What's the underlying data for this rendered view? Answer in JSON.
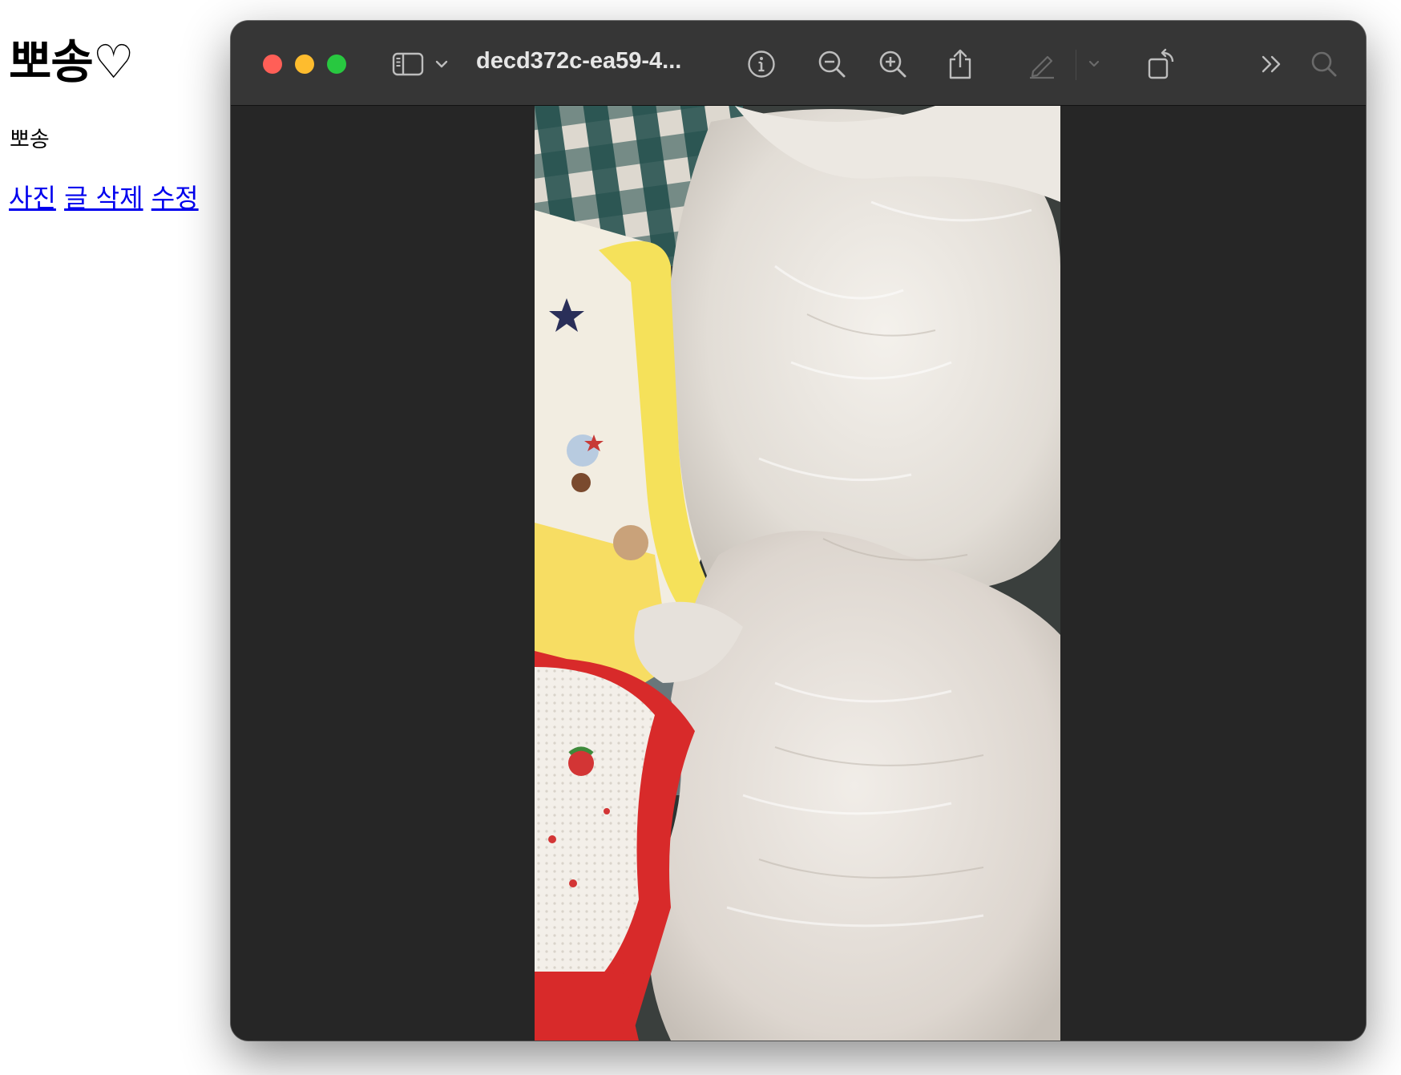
{
  "page": {
    "title": "뽀송♡",
    "subtitle": "뽀송",
    "links": [
      "사진",
      "글 삭제",
      "수정"
    ]
  },
  "window": {
    "title": "decd372c-ea59-4...",
    "traffic_lights": {
      "close": "#ff5f57",
      "minimize": "#febc2e",
      "zoom": "#28c840"
    },
    "toolbar_icons": [
      "sidebar-toggle-icon",
      "chevron-down-icon",
      "info-icon",
      "zoom-out-icon",
      "zoom-in-icon",
      "share-icon",
      "markup-pen-icon",
      "chevron-down-icon",
      "rotate-icon",
      "more-chevrons-icon",
      "search-icon"
    ]
  },
  "photo": {
    "subject": "rotated photo of two white fluffy dogs wearing clothes (yellow-collar shirt and red strawberry shirt) on a checkered cushion"
  }
}
